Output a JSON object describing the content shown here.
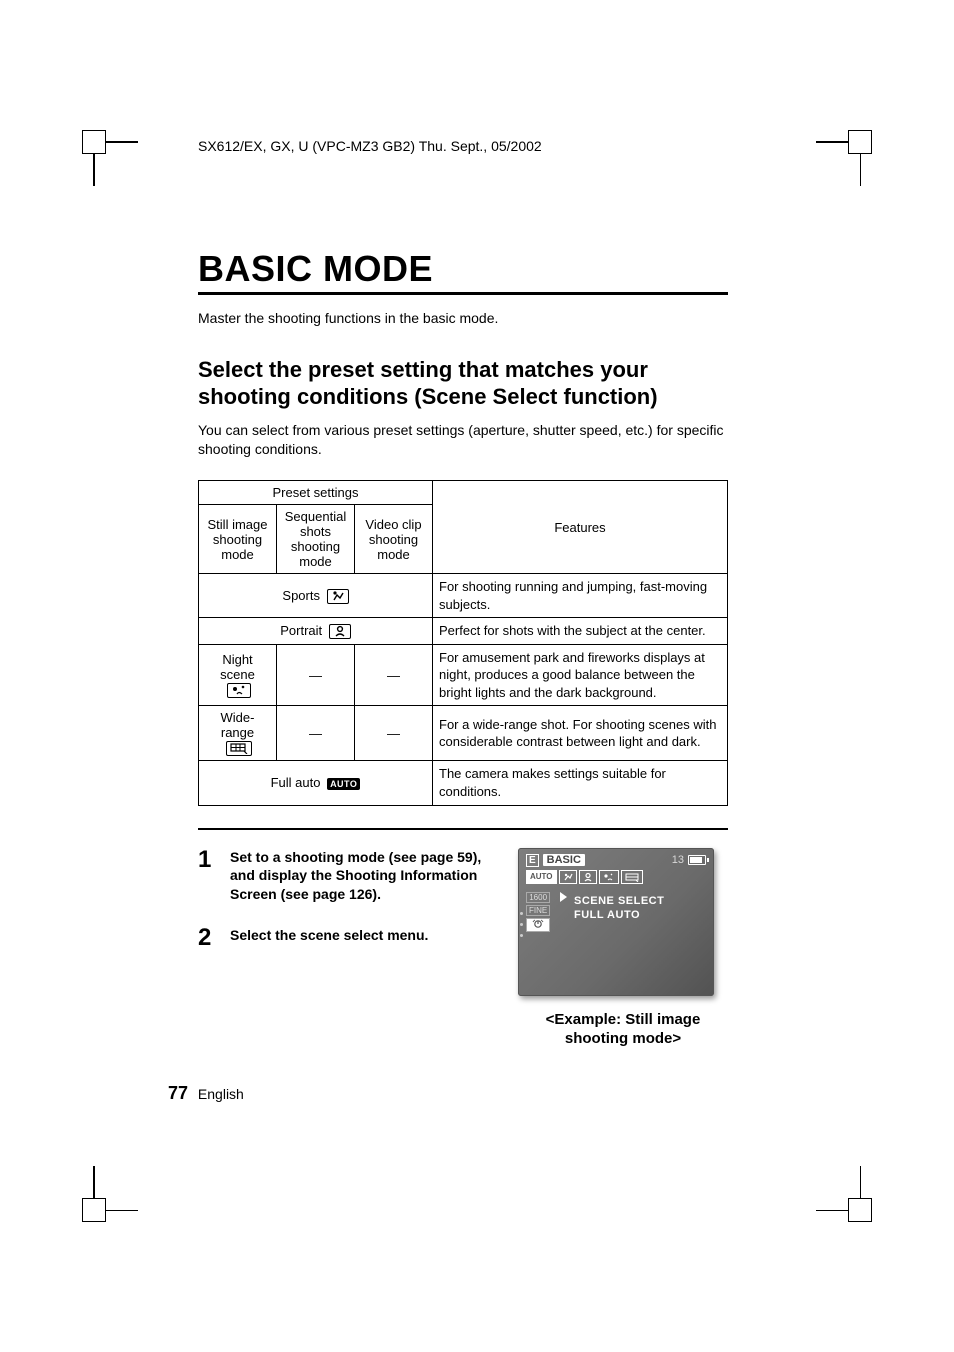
{
  "doc_header": "SX612/EX, GX, U (VPC-MZ3 GB2)    Thu. Sept., 05/2002",
  "title": "BASIC MODE",
  "master_text": "Master the shooting functions in the basic mode.",
  "subtitle": "Select the preset setting that matches your shooting conditions (Scene Select function)",
  "description": "You can select from various preset settings (aperture, shutter speed, etc.) for specific shooting conditions.",
  "table": {
    "preset_header": "Preset settings",
    "col_still": "Still image shooting mode",
    "col_seq": "Sequential shots shooting mode",
    "col_video": "Video clip shooting mode",
    "col_features": "Features",
    "rows": [
      {
        "label": "Sports",
        "icon": "sports",
        "span": true,
        "still": "",
        "seq": "",
        "video": "",
        "feat": "For shooting running and jumping, fast-moving subjects."
      },
      {
        "label": "Portrait",
        "icon": "portrait",
        "span": true,
        "still": "",
        "seq": "",
        "video": "",
        "feat": "Perfect for shots with the subject at the center."
      },
      {
        "label": "Night scene",
        "icon": "night",
        "span": false,
        "still": "",
        "seq": "—",
        "video": "—",
        "feat": "For amusement park and fireworks displays at night, produces a good balance between the bright lights and the dark background."
      },
      {
        "label": "Wide-range",
        "icon": "wide",
        "span": false,
        "still": "",
        "seq": "—",
        "video": "—",
        "feat": "For a wide-range shot. For shooting scenes with considerable contrast between light and dark."
      },
      {
        "label": "Full auto",
        "icon": "auto",
        "span": true,
        "still": "",
        "seq": "",
        "video": "",
        "feat": "The camera makes settings suitable for conditions."
      }
    ]
  },
  "steps": [
    {
      "num": "1",
      "text": "Set to a shooting mode (see page 59), and display the Shooting Information Screen (see page 126)."
    },
    {
      "num": "2",
      "text": "Select the scene select menu."
    }
  ],
  "lcd": {
    "e": "E",
    "basic": "BASIC",
    "count": "13",
    "auto": "AUTO",
    "res": "1600",
    "fine": "FINE",
    "menu_line1": "SCENE SELECT",
    "menu_line2": "FULL AUTO"
  },
  "lcd_caption": "<Example: Still image shooting mode>",
  "footer": {
    "page": "77",
    "lang": "English"
  }
}
